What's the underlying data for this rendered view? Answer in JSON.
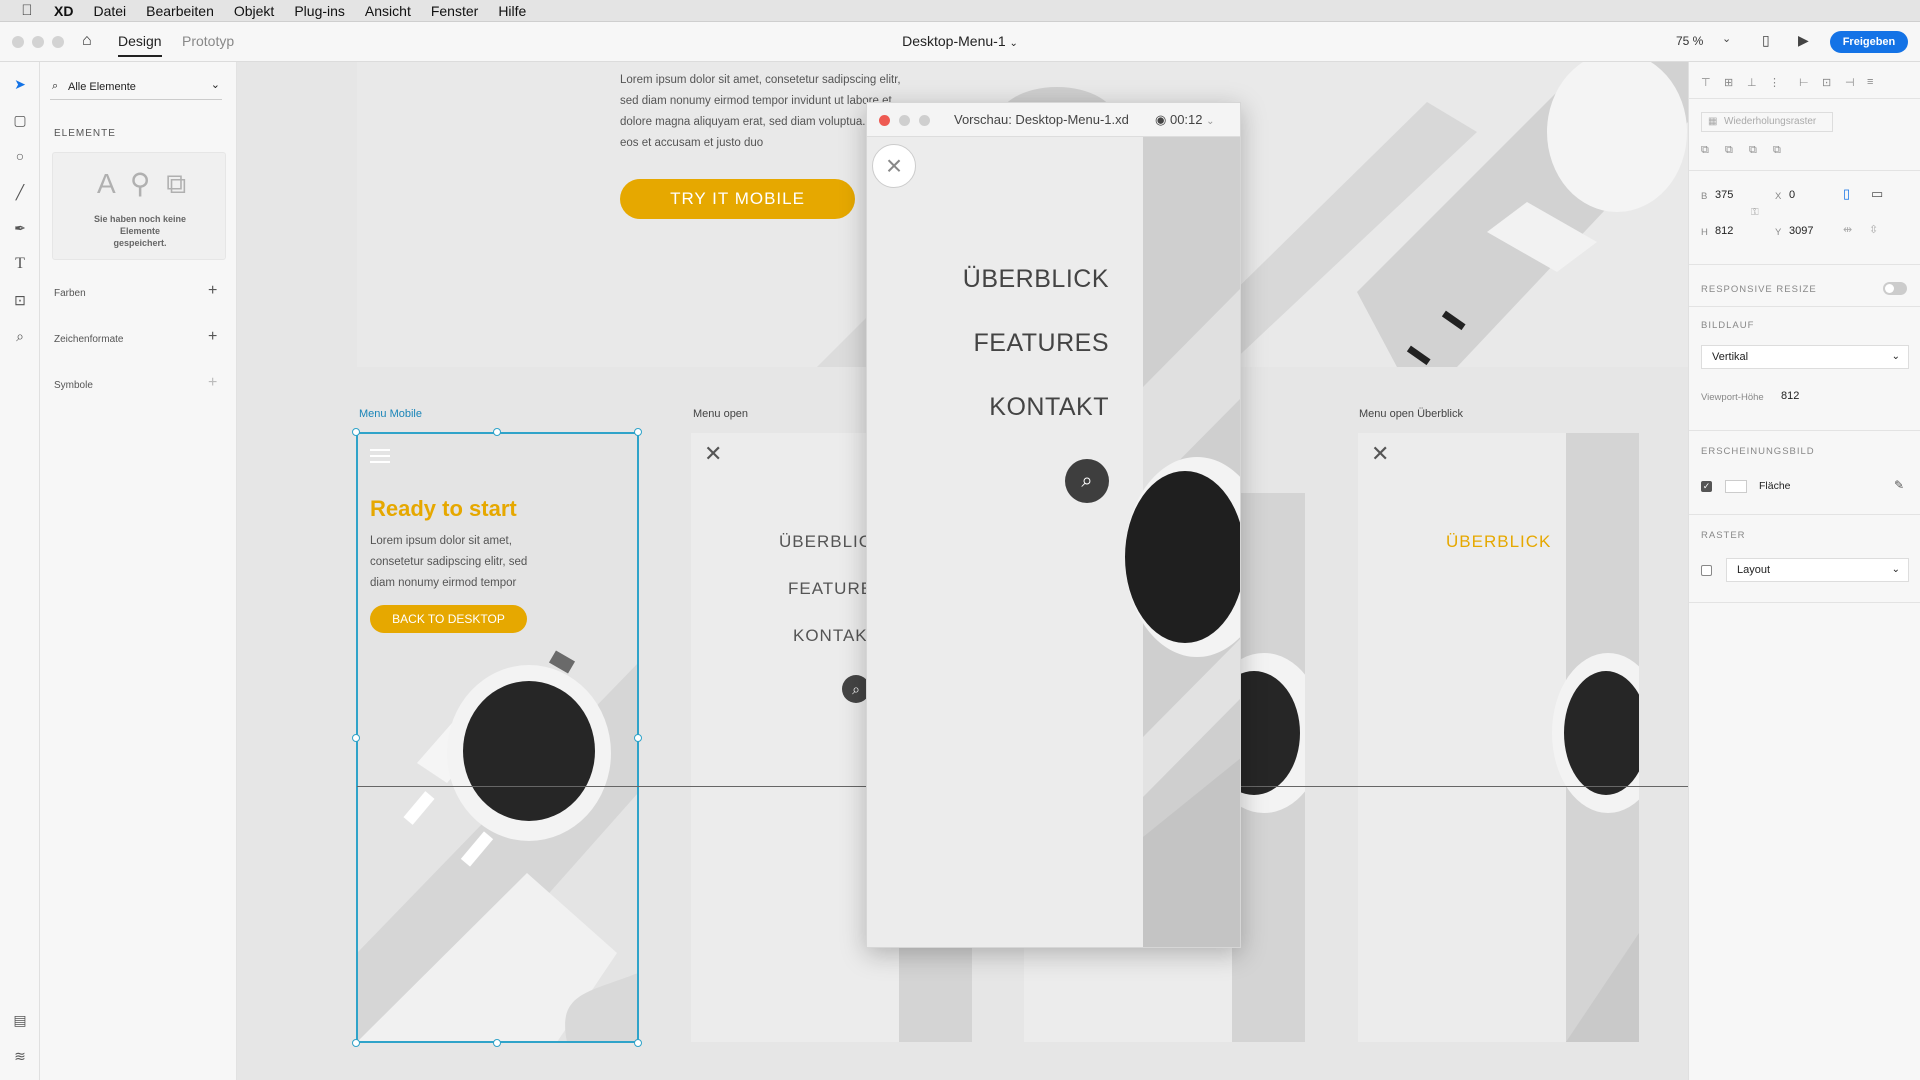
{
  "menubar": {
    "apple": "",
    "items": [
      "XD",
      "Datei",
      "Bearbeiten",
      "Objekt",
      "Plug-ins",
      "Ansicht",
      "Fenster",
      "Hilfe"
    ]
  },
  "toolbar": {
    "tab_design": "Design",
    "tab_prototype": "Prototyp",
    "doc_title": "Desktop-Menu-1",
    "zoom": "75 %",
    "share": "Freigeben"
  },
  "assets": {
    "filter": "Alle Elemente",
    "elements_heading": "ELEMENTE",
    "empty_glyphs": "A ⚲ ⧉",
    "empty_message": "Sie haben noch keine Elemente gespeichert.",
    "colors": "Farben",
    "char_styles": "Zeichenformate",
    "symbols": "Symbole"
  },
  "canvas": {
    "top_lorem": "Lorem ipsum dolor sit amet, consetetur sadipscing elitr, sed diam nonumy eirmod tempor invidunt ut labore et dolore magna aliquyam erat, sed diam voluptua. At vero eos et accusam et justo duo",
    "try_button": "TRY IT MOBILE",
    "artboard_menu_mobile": {
      "label": "Menu Mobile",
      "title": "Ready to start",
      "text": "Lorem ipsum dolor sit amet, consetetur sadipscing elitr, sed diam nonumy eirmod tempor",
      "button": "BACK TO DESKTOP"
    },
    "artboard_menu_open": {
      "label": "Menu open",
      "items": [
        "ÜBERBLICK",
        "FEATURES",
        "KONTAKT"
      ]
    },
    "artboard_menu_open_overview": {
      "label": "Menu open Überblick",
      "active_item": "ÜBERBLICK"
    }
  },
  "preview": {
    "title": "Vorschau: Desktop-Menu-1.xd",
    "recording_time": "00:12",
    "menu_items": [
      "ÜBERBLICK",
      "FEATURES",
      "KONTAKT"
    ]
  },
  "properties": {
    "repeat_grid": "Wiederholungsraster",
    "w_label": "B",
    "w_value": "375",
    "x_label": "X",
    "x_value": "0",
    "h_label": "H",
    "h_value": "812",
    "y_label": "Y",
    "y_value": "3097",
    "responsive_resize": "RESPONSIVE RESIZE",
    "scroll_heading": "BILDLAUF",
    "scroll_value": "Vertikal",
    "viewport_label": "Viewport-Höhe",
    "viewport_value": "812",
    "appearance_heading": "ERSCHEINUNGSBILD",
    "fill_label": "Fläche",
    "grid_heading": "RASTER",
    "grid_value": "Layout"
  },
  "colors": {
    "accent_yellow": "#e6a800",
    "selection_blue": "#2fa3c9",
    "share_blue": "#1473e6",
    "close_red": "#ee5a52"
  }
}
